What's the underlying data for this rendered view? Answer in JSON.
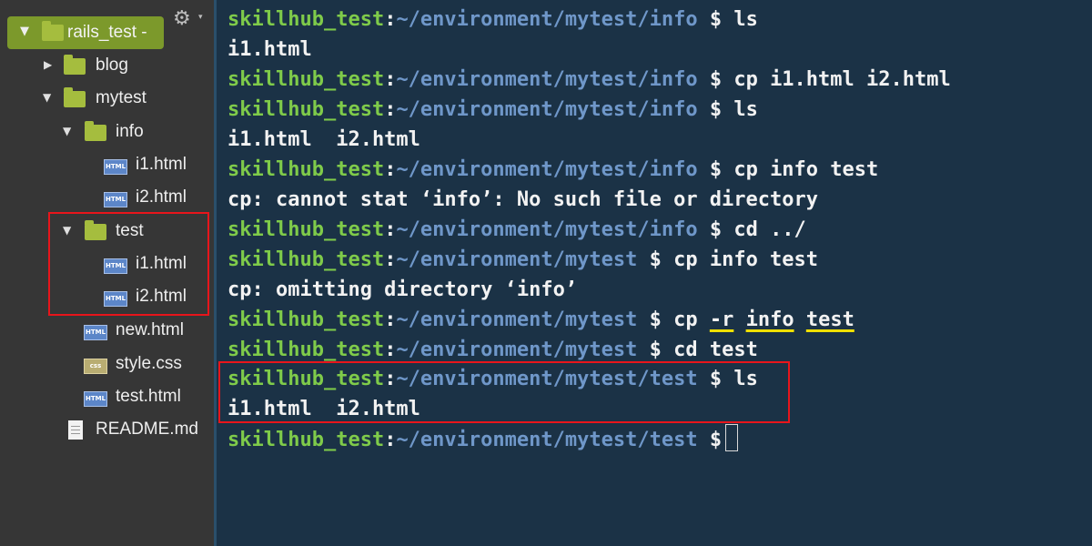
{
  "sidebar": {
    "root": {
      "label": "rails_test -",
      "arrow": "▼"
    },
    "gear_icon": "⚙",
    "gear_caret": "▾",
    "items": [
      {
        "label": "blog",
        "type": "folder",
        "arrow": "▶"
      },
      {
        "label": "mytest",
        "type": "folder",
        "arrow": "▼"
      },
      {
        "label": "info",
        "type": "folder",
        "arrow": "▼"
      },
      {
        "label": "i1.html",
        "type": "html"
      },
      {
        "label": "i2.html",
        "type": "html"
      },
      {
        "label": "test",
        "type": "folder",
        "arrow": "▼"
      },
      {
        "label": "i1.html",
        "type": "html"
      },
      {
        "label": "i2.html",
        "type": "html"
      },
      {
        "label": "new.html",
        "type": "html"
      },
      {
        "label": "style.css",
        "type": "css"
      },
      {
        "label": "test.html",
        "type": "html"
      },
      {
        "label": "README.md",
        "type": "md"
      }
    ],
    "html_icon_text": "HTML",
    "css_icon_text": "css"
  },
  "terminal": {
    "user": "skillhub_test",
    "lines": [
      {
        "kind": "prompt",
        "path": "~/environment/mytest/info",
        "cmd": "ls"
      },
      {
        "kind": "output",
        "text": "i1.html"
      },
      {
        "kind": "prompt",
        "path": "~/environment/mytest/info",
        "cmd": "cp i1.html i2.html"
      },
      {
        "kind": "prompt",
        "path": "~/environment/mytest/info",
        "cmd": "ls"
      },
      {
        "kind": "output",
        "text": "i1.html  i2.html"
      },
      {
        "kind": "prompt",
        "path": "~/environment/mytest/info",
        "cmd": "cp info test"
      },
      {
        "kind": "output",
        "text": "cp: cannot stat ‘info’: No such file or directory"
      },
      {
        "kind": "prompt",
        "path": "~/environment/mytest/info",
        "cmd": "cd ../"
      },
      {
        "kind": "prompt",
        "path": "~/environment/mytest",
        "cmd": "cp info test"
      },
      {
        "kind": "output",
        "text": "cp: omitting directory ‘info’"
      },
      {
        "kind": "prompt",
        "path": "~/environment/mytest",
        "cmd_parts": [
          "cp",
          "-r",
          "info",
          "test"
        ]
      },
      {
        "kind": "prompt",
        "path": "~/environment/mytest",
        "cmd": "cd test"
      },
      {
        "kind": "prompt",
        "path": "~/environment/mytest/test",
        "cmd": "ls"
      },
      {
        "kind": "output",
        "text": "i1.html  i2.html"
      },
      {
        "kind": "prompt",
        "path": "~/environment/mytest/test",
        "cmd": ""
      }
    ]
  },
  "colors": {
    "sidebar_bg": "#363636",
    "terminal_bg": "#1b3246",
    "root_pill": "#7c992b",
    "folder": "#a5bd3e",
    "host_green": "#7fcb4a",
    "path_blue": "#6f97c9",
    "highlight_red": "#e8151b",
    "underline_yellow": "#f0e000"
  }
}
